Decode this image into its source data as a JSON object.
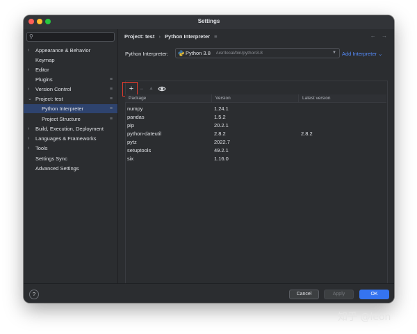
{
  "window": {
    "title": "Settings"
  },
  "search": {
    "placeholder": "",
    "icon": "search-icon"
  },
  "sidebar": {
    "items": [
      {
        "label": "Appearance & Behavior",
        "expandable": true
      },
      {
        "label": "Keymap",
        "expandable": false
      },
      {
        "label": "Editor",
        "expandable": true
      },
      {
        "label": "Plugins",
        "expandable": false,
        "grip": "≡"
      },
      {
        "label": "Version Control",
        "expandable": true,
        "grip": "≡"
      },
      {
        "label": "Project: test",
        "expanded": true,
        "grip": "≡"
      },
      {
        "label": "Python Interpreter",
        "selected": true,
        "grip": "≡"
      },
      {
        "label": "Project Structure",
        "grip": "≡"
      },
      {
        "label": "Build, Execution, Deployment",
        "expandable": true
      },
      {
        "label": "Languages & Frameworks",
        "expandable": true
      },
      {
        "label": "Tools",
        "expandable": true
      },
      {
        "label": "Settings Sync"
      },
      {
        "label": "Advanced Settings"
      }
    ]
  },
  "breadcrumb": {
    "parent": "Project: test",
    "separator": "›",
    "current": "Python Interpreter",
    "grip": "≡"
  },
  "interpreter": {
    "label": "Python Interpreter:",
    "name": "Python 3.8",
    "path": "/usr/local/bin/python3.8",
    "add_label": "Add Interpreter",
    "add_chevron": "⌄"
  },
  "toolbar": {
    "add": "+",
    "remove": "−",
    "up": "▲"
  },
  "table": {
    "headers": [
      "Package",
      "Version",
      "Latest version"
    ],
    "rows": [
      {
        "package": "numpy",
        "version": "1.24.1",
        "latest": ""
      },
      {
        "package": "pandas",
        "version": "1.5.2",
        "latest": ""
      },
      {
        "package": "pip",
        "version": "20.2.1",
        "latest": ""
      },
      {
        "package": "python-dateutil",
        "version": "2.8.2",
        "latest": "2.8.2"
      },
      {
        "package": "pytz",
        "version": "2022.7",
        "latest": ""
      },
      {
        "package": "setuptools",
        "version": "49.2.1",
        "latest": ""
      },
      {
        "package": "six",
        "version": "1.16.0",
        "latest": ""
      }
    ]
  },
  "footer": {
    "help": "?",
    "cancel": "Cancel",
    "apply": "Apply",
    "ok": "OK"
  },
  "watermark": "知乎 @leon",
  "colors": {
    "accent": "#3574f0",
    "selection": "#2e436e",
    "highlight_box": "#e03b2e"
  }
}
